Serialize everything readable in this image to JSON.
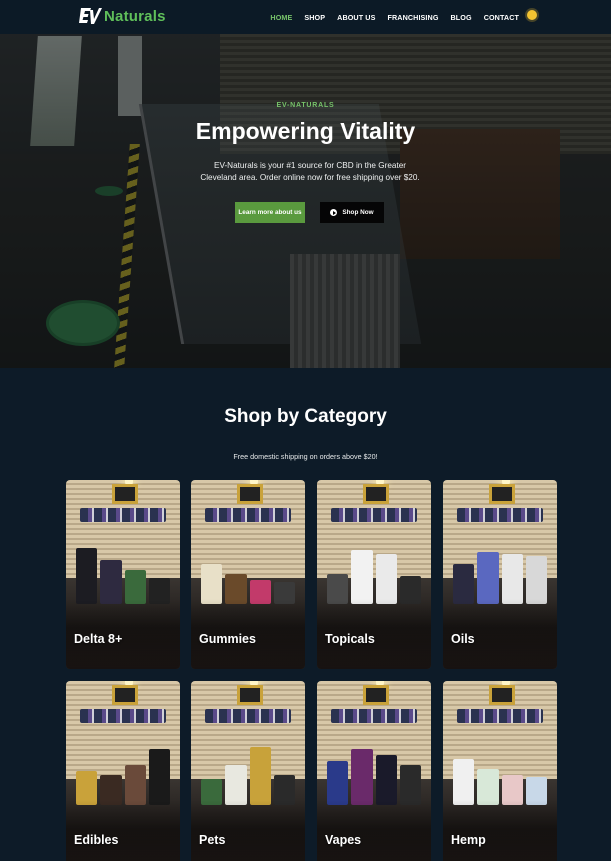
{
  "brand": {
    "logo_text": "Naturals",
    "logo_icon": "ev-logo-icon",
    "accent_color": "#5fbf5a"
  },
  "nav": {
    "items": [
      {
        "label": "HOME",
        "active": true
      },
      {
        "label": "SHOP",
        "active": false
      },
      {
        "label": "ABOUT US",
        "active": false
      },
      {
        "label": "FRANCHISING",
        "active": false
      },
      {
        "label": "BLOG",
        "active": false
      },
      {
        "label": "CONTACT",
        "active": false
      }
    ],
    "theme_toggle_icon": "sun-icon"
  },
  "hero": {
    "kicker": "EV-NATURALS",
    "title": "Empowering Vitality",
    "subtitle": "EV-Naturals is your #1 source for CBD in the Greater Cleveland area. Order online now for free shipping over $20.",
    "primary_button": "Learn more about us",
    "secondary_button": "Shop Now",
    "secondary_icon": "play-circle-icon",
    "primary_button_color": "#5a9a3e"
  },
  "categories": {
    "title": "Shop by Category",
    "subtitle": "Free domestic shipping on orders above $20!",
    "items": [
      {
        "label": "Delta 8+"
      },
      {
        "label": "Gummies"
      },
      {
        "label": "Topicals"
      },
      {
        "label": "Oils"
      },
      {
        "label": "Edibles"
      },
      {
        "label": "Pets"
      },
      {
        "label": "Vapes"
      },
      {
        "label": "Hemp"
      }
    ]
  },
  "colors": {
    "page_background": "#0d1b28",
    "header_background": "#0c1a26",
    "active_nav": "#77c36a"
  }
}
